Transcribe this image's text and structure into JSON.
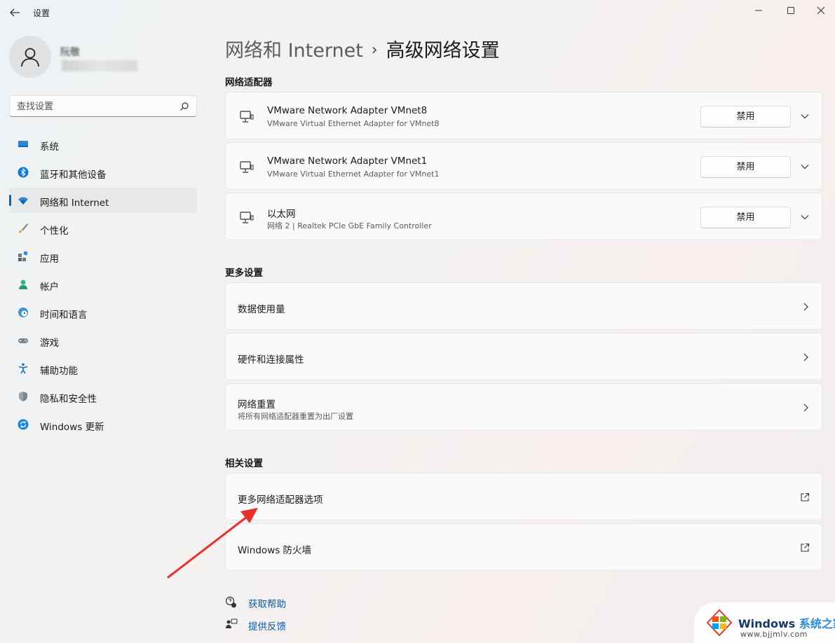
{
  "window": {
    "title": "设置"
  },
  "user": {
    "name": "阮敬"
  },
  "search": {
    "placeholder": "查找设置"
  },
  "nav": [
    {
      "label": "系统",
      "icon": "system-icon"
    },
    {
      "label": "蓝牙和其他设备",
      "icon": "bluetooth-icon"
    },
    {
      "label": "网络和 Internet",
      "icon": "wifi-icon",
      "active": true
    },
    {
      "label": "个性化",
      "icon": "brush-icon"
    },
    {
      "label": "应用",
      "icon": "apps-icon"
    },
    {
      "label": "帐户",
      "icon": "account-icon"
    },
    {
      "label": "时间和语言",
      "icon": "clock-globe-icon"
    },
    {
      "label": "游戏",
      "icon": "gamepad-icon"
    },
    {
      "label": "辅助功能",
      "icon": "accessibility-icon"
    },
    {
      "label": "隐私和安全性",
      "icon": "shield-icon"
    },
    {
      "label": "Windows 更新",
      "icon": "update-icon"
    }
  ],
  "breadcrumb": {
    "parent": "网络和 Internet",
    "separator": "›",
    "current": "高级网络设置"
  },
  "adapters": {
    "heading": "网络适配器",
    "items": [
      {
        "name": "VMware Network Adapter VMnet8",
        "desc": "VMware Virtual Ethernet Adapter for VMnet8",
        "button": "禁用"
      },
      {
        "name": "VMware Network Adapter VMnet1",
        "desc": "VMware Virtual Ethernet Adapter for VMnet1",
        "button": "禁用"
      },
      {
        "name": "以太网",
        "desc": "网络 2 | Realtek PCIe GbE Family Controller",
        "button": "禁用"
      }
    ]
  },
  "more": {
    "heading": "更多设置",
    "items": [
      {
        "label": "数据使用量"
      },
      {
        "label": "硬件和连接属性"
      },
      {
        "label": "网络重置",
        "sub": "将所有网络适配器重置为出厂设置"
      }
    ]
  },
  "related": {
    "heading": "相关设置",
    "items": [
      {
        "label": "更多网络适配器选项"
      },
      {
        "label": "Windows 防火墙"
      }
    ]
  },
  "help": {
    "get_help": "获取帮助",
    "feedback": "提供反馈"
  },
  "watermark": {
    "brand": "Windows",
    "suffix": "系统之家",
    "url": "www.bjjmlv.com"
  },
  "colors": {
    "accent": "#0067c0",
    "annotation_arrow": "#e8302a"
  }
}
